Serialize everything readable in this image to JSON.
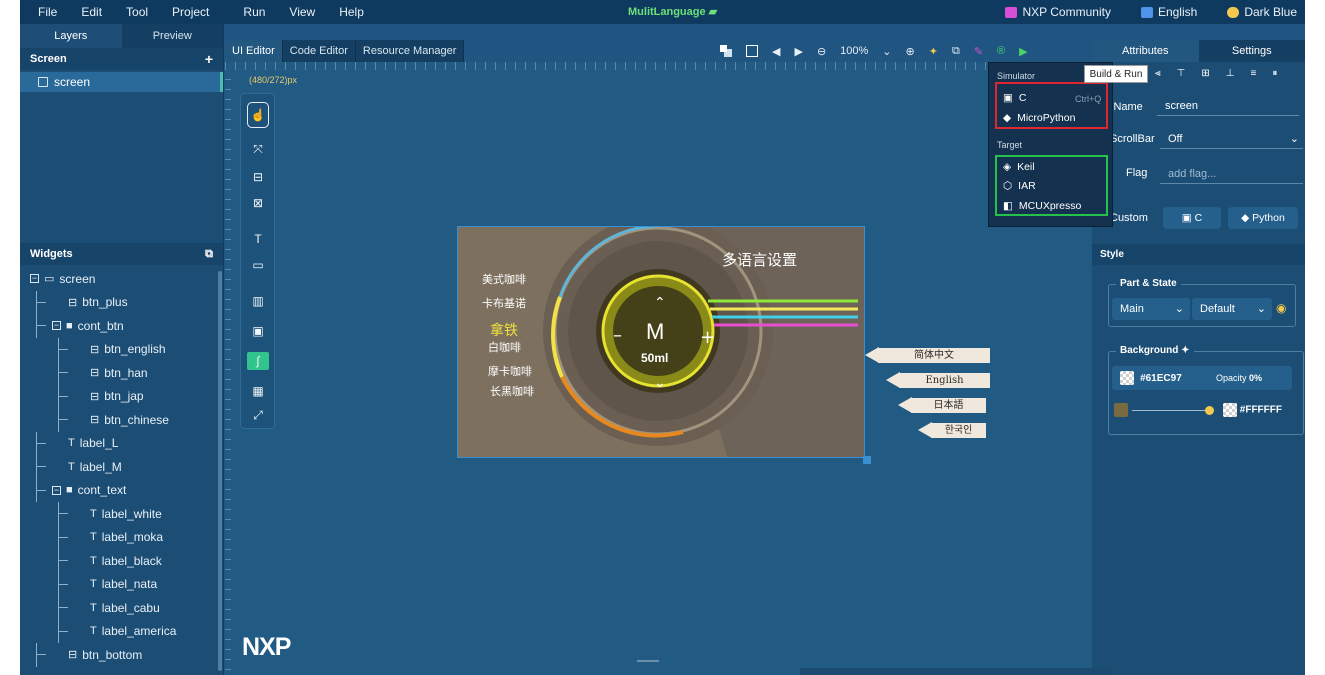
{
  "menu": {
    "items": [
      "File",
      "Edit",
      "Tool",
      "Project",
      "Run",
      "View",
      "Help"
    ],
    "project_title": "MulitLanguage",
    "right": [
      {
        "label": "NXP Community",
        "icon": "community-icon",
        "color": "#d64fd6"
      },
      {
        "label": "English",
        "icon": "language-icon",
        "color": "#4f94e8"
      },
      {
        "label": "Dark Blue",
        "icon": "palette-icon",
        "color": "#f2c94c"
      }
    ]
  },
  "left_panel": {
    "tabs": [
      "Layers",
      "Preview"
    ],
    "screen_header": "Screen",
    "screen_item": "screen",
    "widgets_header": "Widgets",
    "tree": [
      {
        "label": "screen",
        "icon": "screen-icon",
        "depth": 0,
        "expander": "minus"
      },
      {
        "label": "btn_plus",
        "icon": "button-icon",
        "depth": 1
      },
      {
        "label": "cont_btn",
        "icon": "container-icon",
        "depth": 1,
        "expander": "minus"
      },
      {
        "label": "btn_english",
        "icon": "button-icon",
        "depth": 2
      },
      {
        "label": "btn_han",
        "icon": "button-icon",
        "depth": 2
      },
      {
        "label": "btn_jap",
        "icon": "button-icon",
        "depth": 2
      },
      {
        "label": "btn_chinese",
        "icon": "button-icon",
        "depth": 2
      },
      {
        "label": "label_L",
        "icon": "label-icon",
        "depth": 1
      },
      {
        "label": "label_M",
        "icon": "label-icon",
        "depth": 1
      },
      {
        "label": "cont_text",
        "icon": "container-icon",
        "depth": 1,
        "expander": "minus"
      },
      {
        "label": "label_white",
        "icon": "label-icon",
        "depth": 2
      },
      {
        "label": "label_moka",
        "icon": "label-icon",
        "depth": 2
      },
      {
        "label": "label_black",
        "icon": "label-icon",
        "depth": 2
      },
      {
        "label": "label_nata",
        "icon": "label-icon",
        "depth": 2
      },
      {
        "label": "label_cabu",
        "icon": "label-icon",
        "depth": 2
      },
      {
        "label": "label_america",
        "icon": "label-icon",
        "depth": 2
      },
      {
        "label": "btn_bottom",
        "icon": "button-icon",
        "depth": 1
      }
    ]
  },
  "editor": {
    "tabs": [
      "UI Editor",
      "Code Editor",
      "Resource Manager"
    ],
    "zoom": "100%",
    "dimensions": "(480/272)px",
    "logo": "NXP"
  },
  "preview": {
    "title": "多语言设置",
    "coffees": [
      "美式咖啡",
      "卡布基诺",
      "拿铁",
      "白咖啡",
      "摩卡咖啡",
      "长黑咖啡"
    ],
    "size": "M",
    "volume": "50ml",
    "languages": [
      "简体中文",
      "English",
      "日本語",
      "한국인"
    ],
    "stripe_colors": [
      "#8ee83c",
      "#f2e85a",
      "#41d0e8",
      "#e84fd0"
    ]
  },
  "dropdown": {
    "simulator_label": "Simulator",
    "simulator_items": [
      {
        "label": "C",
        "shortcut": "Ctrl+Q",
        "icon": "c-icon"
      },
      {
        "label": "MicroPython",
        "icon": "python-icon"
      }
    ],
    "target_label": "Target",
    "target_items": [
      {
        "label": "Keil",
        "icon": "keil-icon"
      },
      {
        "label": "IAR",
        "icon": "iar-icon"
      },
      {
        "label": "MCUXpresso",
        "icon": "mcuxpresso-icon"
      }
    ]
  },
  "right_panel": {
    "tabs": [
      "Attributes",
      "Settings"
    ],
    "tooltip": "Build & Run",
    "name_label": "Name",
    "name_value": "screen",
    "scrollbar_label": "ScrollBar",
    "scrollbar_value": "Off",
    "flag_label": "Flag",
    "flag_placeholder": "add flag...",
    "custom_label": "Custom",
    "custom_c": "C",
    "custom_python": "Python",
    "style_header": "Style",
    "part_state_title": "Part & State",
    "part_value": "Main",
    "state_value": "Default",
    "background_title": "Background",
    "bg_color": "#61EC97",
    "opacity_label": "Opacity",
    "opacity_value": "0%",
    "grad_color": "#FFFFFF"
  }
}
